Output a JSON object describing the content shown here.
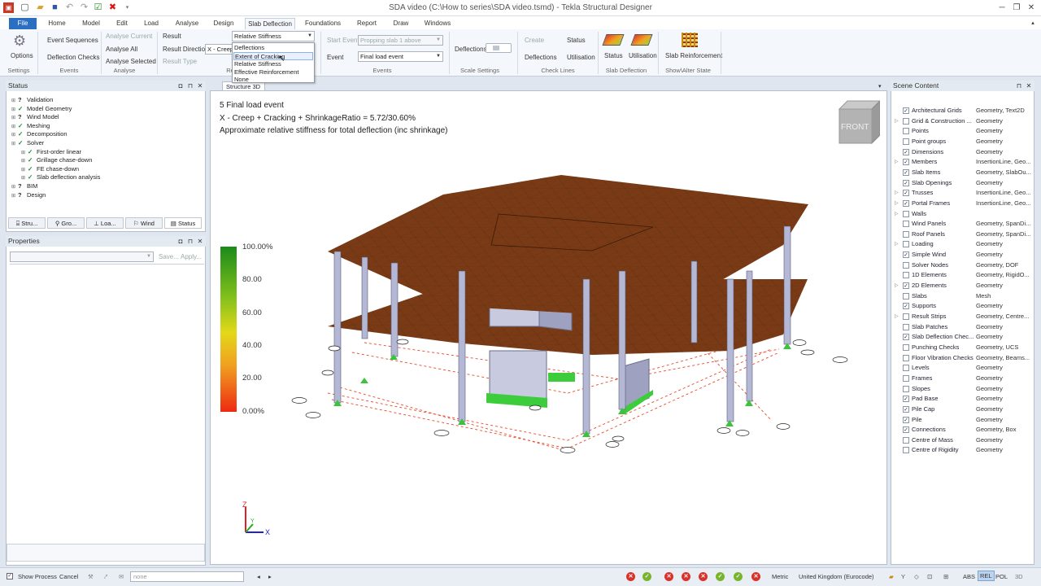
{
  "window": {
    "title": "SDA video (C:\\How to series\\SDA video.tsmd) - Tekla Structural Designer"
  },
  "tabs": [
    "File",
    "Home",
    "Model",
    "Edit",
    "Load",
    "Analyse",
    "Design",
    "Slab Deflection",
    "Foundations",
    "Report",
    "Draw",
    "Windows"
  ],
  "ribbon": {
    "options": "Options",
    "settings_group": "Settings",
    "event_sequences": "Event Sequences",
    "deflection_checks": "Deflection Checks",
    "events_group": "Events",
    "analyse_current": "Analyse Current",
    "analyse_all": "Analyse All",
    "analyse_selected": "Analyse Selected",
    "analyse_group": "Analyse",
    "result_label": "Result",
    "result_value": "Relative Stiffness",
    "result_direction_label": "Result Direction",
    "result_direction_value": "X - Creep",
    "result_type_label": "Result Type",
    "results_group": "Re",
    "start_event_label": "Start Event",
    "start_event_value": "Propping slab 1 above",
    "event_label": "Event",
    "event_value": "Final load event",
    "events_group2": "Events",
    "deflections": "Deflections",
    "scale_settings_group": "Scale Settings",
    "create": "Create",
    "deflections2": "Deflections",
    "status": "Status",
    "utilisation": "Utilisation",
    "check_lines_group": "Check Lines",
    "status2": "Status",
    "utilisation2": "Utilisation",
    "slab_deflection_group": "Slab Deflection",
    "slab_reinforcement": "Slab Reinforcement",
    "show_alter_group": "Show\\Alter State"
  },
  "result_dropdown": [
    "Deflections",
    "Extent of Cracking",
    "Relative Stiffness",
    "Effective Reinforcement",
    "None"
  ],
  "status_panel": {
    "title": "Status",
    "items": [
      {
        "label": "Validation",
        "indent": 0,
        "icon": "?"
      },
      {
        "label": "Model Geometry",
        "indent": 0,
        "icon": "✓"
      },
      {
        "label": "Wind Model",
        "indent": 0,
        "icon": "?"
      },
      {
        "label": "Meshing",
        "indent": 0,
        "icon": "✓"
      },
      {
        "label": "Decomposition",
        "indent": 0,
        "icon": "✓"
      },
      {
        "label": "Solver",
        "indent": 0,
        "icon": "✓"
      },
      {
        "label": "First-order linear",
        "indent": 1,
        "icon": "✓"
      },
      {
        "label": "Grillage chase-down",
        "indent": 1,
        "icon": "✓"
      },
      {
        "label": "FE chase-down",
        "indent": 1,
        "icon": "✓"
      },
      {
        "label": "Slab deflection analysis",
        "indent": 1,
        "icon": "✓"
      },
      {
        "label": "BIM",
        "indent": 0,
        "icon": "?"
      },
      {
        "label": "Design",
        "indent": 0,
        "icon": "?"
      }
    ],
    "tabs": [
      "Stru...",
      "Gro...",
      "Loa...",
      "Wind",
      "Status"
    ]
  },
  "properties_panel": {
    "title": "Properties",
    "save": "Save...",
    "apply": "Apply..."
  },
  "viewport": {
    "tab": "Structure 3D",
    "line1": "5 Final load event",
    "line2": "X - Creep + Cracking + ShrinkageRatio = 5.72/30.60%",
    "line3": "Approximate relative stiffness for total deflection (inc shrinkage)",
    "legend": [
      "100.00%",
      "80.00",
      "60.00",
      "40.00",
      "20.00",
      "0.00%"
    ],
    "cube_label": "FRONT",
    "axes": {
      "z": "Z",
      "y": "Y",
      "x": "X"
    }
  },
  "scene_content": {
    "title": "Scene Content",
    "rows": [
      {
        "name": "Architectural Grids",
        "type": "Geometry, Text2D",
        "checked": true,
        "exp": false
      },
      {
        "name": "Grid & Construction ...",
        "type": "Geometry",
        "checked": false,
        "exp": true
      },
      {
        "name": "Points",
        "type": "Geometry",
        "checked": false,
        "exp": false
      },
      {
        "name": "Point groups",
        "type": "Geometry",
        "checked": false,
        "exp": false
      },
      {
        "name": "Dimensions",
        "type": "Geometry",
        "checked": true,
        "exp": false
      },
      {
        "name": "Members",
        "type": "InsertionLine, Geo...",
        "checked": true,
        "exp": true
      },
      {
        "name": "Slab Items",
        "type": "Geometry, SlabOu...",
        "checked": true,
        "exp": false
      },
      {
        "name": "Slab Openings",
        "type": "Geometry",
        "checked": true,
        "exp": false
      },
      {
        "name": "Trusses",
        "type": "InsertionLine, Geo...",
        "checked": true,
        "exp": true
      },
      {
        "name": "Portal Frames",
        "type": "InsertionLine, Geo...",
        "checked": true,
        "exp": true
      },
      {
        "name": "Walls",
        "type": "",
        "checked": false,
        "exp": true
      },
      {
        "name": "Wind Panels",
        "type": "Geometry, SpanDi...",
        "checked": false,
        "exp": false
      },
      {
        "name": "Roof Panels",
        "type": "Geometry, SpanDi...",
        "checked": false,
        "exp": false
      },
      {
        "name": "Loading",
        "type": "Geometry",
        "checked": false,
        "exp": true
      },
      {
        "name": "Simple Wind",
        "type": "Geometry",
        "checked": true,
        "exp": false
      },
      {
        "name": "Solver Nodes",
        "type": "Geometry, DOF",
        "checked": false,
        "exp": false
      },
      {
        "name": "1D Elements",
        "type": "Geometry, RigidO...",
        "checked": false,
        "exp": false
      },
      {
        "name": "2D Elements",
        "type": "Geometry",
        "checked": true,
        "exp": true
      },
      {
        "name": "Slabs",
        "type": "Mesh",
        "checked": false,
        "exp": false
      },
      {
        "name": "Supports",
        "type": "Geometry",
        "checked": true,
        "exp": false
      },
      {
        "name": "Result Strips",
        "type": "Geometry, Centre...",
        "checked": false,
        "exp": true
      },
      {
        "name": "Slab Patches",
        "type": "Geometry",
        "checked": false,
        "exp": false
      },
      {
        "name": "Slab Deflection Chec...",
        "type": "Geometry",
        "checked": true,
        "exp": false
      },
      {
        "name": "Punching Checks",
        "type": "Geometry, UCS",
        "checked": false,
        "exp": false
      },
      {
        "name": "Floor Vibration Checks",
        "type": "Geometry, Beams...",
        "checked": false,
        "exp": false
      },
      {
        "name": "Levels",
        "type": "Geometry",
        "checked": false,
        "exp": false
      },
      {
        "name": "Frames",
        "type": "Geometry",
        "checked": false,
        "exp": false
      },
      {
        "name": "Slopes",
        "type": "Geometry",
        "checked": false,
        "exp": false
      },
      {
        "name": "Pad Base",
        "type": "Geometry",
        "checked": true,
        "exp": false
      },
      {
        "name": "Pile Cap",
        "type": "Geometry",
        "checked": true,
        "exp": false
      },
      {
        "name": "Pile",
        "type": "Geometry",
        "checked": true,
        "exp": false
      },
      {
        "name": "Connections",
        "type": "Geometry, Box",
        "checked": true,
        "exp": false
      },
      {
        "name": "Centre of Mass",
        "type": "Geometry",
        "checked": false,
        "exp": false
      },
      {
        "name": "Centre of Rigidity",
        "type": "Geometry",
        "checked": false,
        "exp": false
      }
    ]
  },
  "statusbar": {
    "show_process": "Show Process",
    "cancel": "Cancel",
    "filter_value": "none",
    "metric": "Metric",
    "region": "United Kingdom (Eurocode)",
    "abs": "ABS",
    "rel": "REL",
    "pol": "POL",
    "mode3d": "3D"
  }
}
